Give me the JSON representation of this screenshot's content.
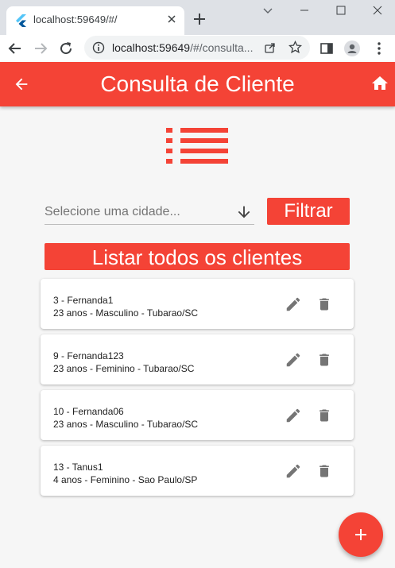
{
  "browser": {
    "tab_title": "localhost:59649/#/",
    "url_host": "localhost:59649",
    "url_path": "/#/consulta..."
  },
  "appbar": {
    "title": "Consulta de Cliente",
    "back_icon": "arrow-back-icon",
    "home_icon": "home-icon"
  },
  "filter": {
    "city_placeholder": "Selecione uma cidade...",
    "filter_label": "Filtrar",
    "list_all_label": "Listar todos os clientes"
  },
  "clients": [
    {
      "title": "3 - Fernanda1",
      "details": "23 anos - Masculino - Tubarao/SC"
    },
    {
      "title": "9 - Fernanda123",
      "details": "23 anos - Feminino - Tubarao/SC"
    },
    {
      "title": "10 - Fernanda06",
      "details": "23 anos - Masculino - Tubarao/SC"
    },
    {
      "title": "13 - Tanus1",
      "details": "4 anos - Feminino - Sao Paulo/SP"
    }
  ],
  "colors": {
    "primary": "#f44336",
    "icon_grey": "#757575"
  },
  "fab_icon": "add-icon"
}
